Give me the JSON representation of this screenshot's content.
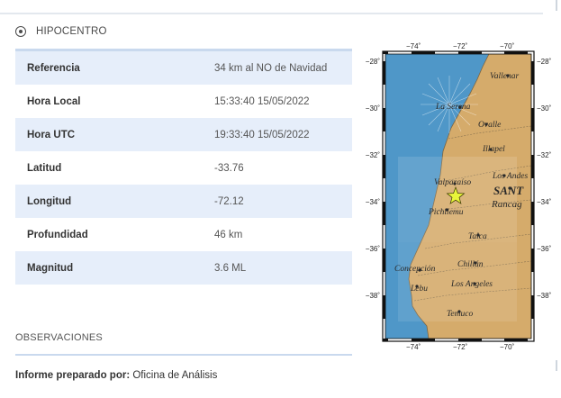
{
  "section": {
    "title": "HIPOCENTRO",
    "icon": "target-icon"
  },
  "rows": [
    {
      "key": "Referencia",
      "value": "34 km al NO de Navidad"
    },
    {
      "key": "Hora Local",
      "value": "15:33:40 15/05/2022"
    },
    {
      "key": "Hora UTC",
      "value": "19:33:40 15/05/2022"
    },
    {
      "key": "Latitud",
      "value": "-33.76"
    },
    {
      "key": "Longitud",
      "value": "-72.12"
    },
    {
      "key": "Profundidad",
      "value": "46 km"
    },
    {
      "key": "Magnitud",
      "value": "3.6 ML"
    }
  ],
  "observations": {
    "title": "OBSERVACIONES"
  },
  "report": {
    "label": "Informe preparado por:",
    "value": "Oficina de Análisis"
  },
  "map": {
    "lon_labels": [
      "−74˚",
      "−72˚",
      "−70˚"
    ],
    "lat_labels": [
      "−28˚",
      "−30˚",
      "−32˚",
      "−34˚",
      "−36˚",
      "−38˚"
    ],
    "places": {
      "vallenar": "Vallenar",
      "la_serena": "La Serena",
      "ovalle": "Ovalle",
      "illapel": "Illapel",
      "los_andes": "Los Andes",
      "valparaiso": "Valparaíso",
      "santiago": "SANT",
      "rancagua": "Rancag",
      "pichilemu": "Pichilemu",
      "talca": "Talca",
      "chillan": "Chillán",
      "concepcion": "Concepción",
      "los_angeles": "Los Angeles",
      "lebu": "Lebu",
      "temuco": "Temuco"
    },
    "colors": {
      "ocean": "#4f97c8",
      "land": "#d5ab6b",
      "epicenter": "#e8f53a"
    }
  }
}
